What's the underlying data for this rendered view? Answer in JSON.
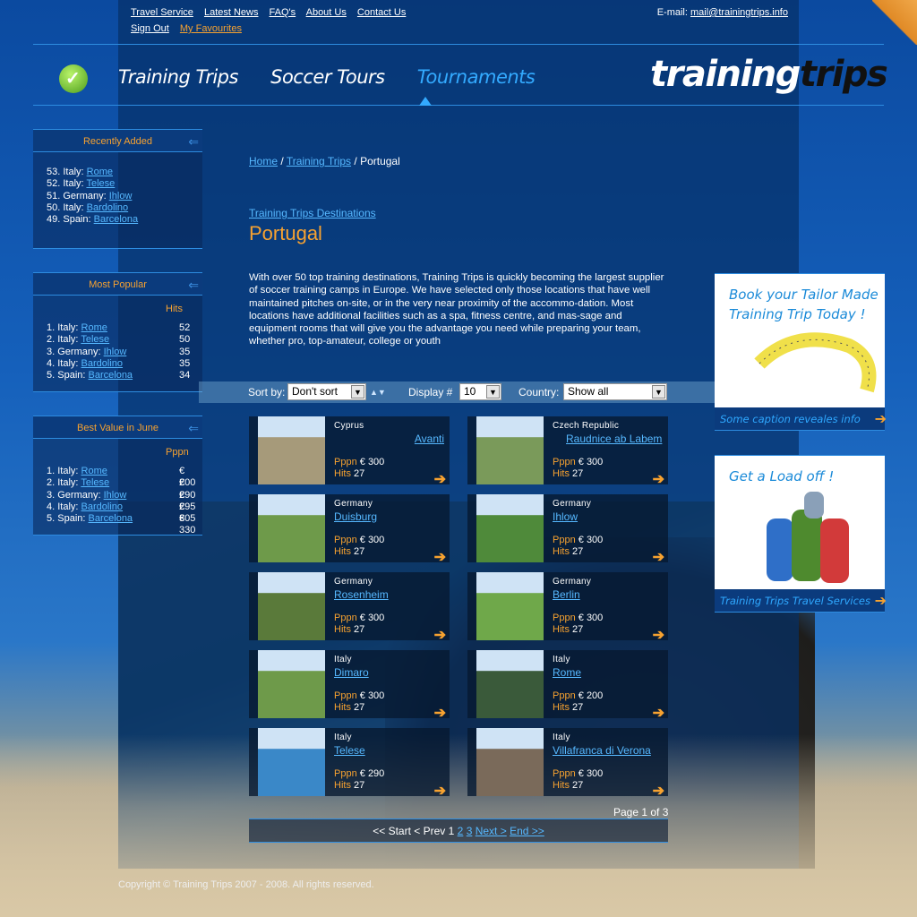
{
  "top_links": [
    "Travel Service",
    "Latest News",
    "FAQ's",
    "About Us",
    "Contact Us"
  ],
  "account_links": [
    "Sign Out",
    "My Favourites"
  ],
  "email": {
    "label": "E-mail:",
    "address": "mail@trainingtrips.info"
  },
  "main_nav": [
    "Training Trips",
    "Soccer Tours",
    "Tournaments"
  ],
  "active_nav": "Tournaments",
  "logo": {
    "part1": "training",
    "part2": "trips"
  },
  "recently_added": {
    "title": "Recently Added",
    "items": [
      {
        "num": "53.",
        "country": "Italy:",
        "city": "Rome"
      },
      {
        "num": "52.",
        "country": "Italy:",
        "city": "Telese"
      },
      {
        "num": "51.",
        "country": "Germany:",
        "city": "Ihlow"
      },
      {
        "num": "50.",
        "country": "Italy:",
        "city": "Bardolino"
      },
      {
        "num": "49.",
        "country": "Spain:",
        "city": "Barcelona"
      }
    ]
  },
  "most_popular": {
    "title": "Most Popular",
    "col": "Hits",
    "items": [
      {
        "num": "1.",
        "country": "Italy:",
        "city": "Rome",
        "val": "52"
      },
      {
        "num": "2.",
        "country": "Italy:",
        "city": "Telese",
        "val": "50"
      },
      {
        "num": "3.",
        "country": "Germany:",
        "city": "Ihlow",
        "val": "35"
      },
      {
        "num": "4.",
        "country": "Italy:",
        "city": "Bardolino",
        "val": "35"
      },
      {
        "num": "5.",
        "country": "Spain:",
        "city": "Barcelona",
        "val": "34"
      }
    ]
  },
  "best_value": {
    "title": "Best Value in June",
    "col": "Pppn",
    "items": [
      {
        "num": "1.",
        "country": "Italy:",
        "city": "Rome",
        "val": "€ 200"
      },
      {
        "num": "2.",
        "country": "Italy:",
        "city": "Telese",
        "val": "€ 290"
      },
      {
        "num": "3.",
        "country": "Germany:",
        "city": "Ihlow",
        "val": "€ 295"
      },
      {
        "num": "4.",
        "country": "Italy:",
        "city": "Bardolino",
        "val": "€ 305"
      },
      {
        "num": "5.",
        "country": "Spain:",
        "city": "Barcelona",
        "val": "€ 330"
      }
    ]
  },
  "breadcrumb": {
    "home": "Home",
    "sep": " / ",
    "section": "Training Trips",
    "current": "Portugal"
  },
  "dest_link": "Training Trips Destinations",
  "page_title": "Portugal",
  "intro": "With over 50 top training destinations, Training Trips is quickly becoming the largest supplier of soccer training camps in Europe. We have selected only those locations that have well maintained pitches on-site, or in the very near proximity of the accommo-dation. Most locations have additional facilities such as a spa, fitness centre, and mas-sage and equipment rooms that will give you the advantage you need while preparing your team, whether pro, top-amateur, college or youth",
  "filters": {
    "sort_label": "Sort by:",
    "sort_value": "Don't sort",
    "display_label": "Display #",
    "display_value": "10",
    "country_label": "Country:",
    "country_value": "Show all"
  },
  "cards": [
    {
      "country": "Cyprus",
      "city": "Avanti",
      "pppn_label": "Pppn",
      "price": "€ 300",
      "hits_label": "Hits",
      "hits": "27",
      "photo": "#a69a7a"
    },
    {
      "country": "Czech Republic",
      "city": "Raudnice ab Labem",
      "pppn_label": "Pppn",
      "price": "€ 300",
      "hits_label": "Hits",
      "hits": "27",
      "photo": "#7a9a5a"
    },
    {
      "country": "Germany",
      "city": "Duisburg",
      "pppn_label": "Pppn",
      "price": "€ 300",
      "hits_label": "Hits",
      "hits": "27",
      "photo": "#6e9a4a"
    },
    {
      "country": "Germany",
      "city": "Ihlow",
      "pppn_label": "Pppn",
      "price": "€ 300",
      "hits_label": "Hits",
      "hits": "27",
      "photo": "#4f8a3a"
    },
    {
      "country": "Germany",
      "city": "Rosenheim",
      "pppn_label": "Pppn",
      "price": "€ 300",
      "hits_label": "Hits",
      "hits": "27",
      "photo": "#5a7a3a"
    },
    {
      "country": "Germany",
      "city": "Berlin",
      "pppn_label": "Pppn",
      "price": "€ 300",
      "hits_label": "Hits",
      "hits": "27",
      "photo": "#6fa84a"
    },
    {
      "country": "Italy",
      "city": "Dimaro",
      "pppn_label": "Pppn",
      "price": "€ 300",
      "hits_label": "Hits",
      "hits": "27",
      "photo": "#6e9a4a"
    },
    {
      "country": "Italy",
      "city": "Rome",
      "pppn_label": "Pppn",
      "price": "€ 200",
      "hits_label": "Hits",
      "hits": "27",
      "photo": "#3a5a3a"
    },
    {
      "country": "Italy",
      "city": "Telese",
      "pppn_label": "Pppn",
      "price": "€ 290",
      "hits_label": "Hits",
      "hits": "27",
      "photo": "#3a88c8"
    },
    {
      "country": "Italy",
      "city": "Villafranca di Verona",
      "pppn_label": "Pppn",
      "price": "€ 300",
      "hits_label": "Hits",
      "hits": "27",
      "photo": "#7a6a5a"
    }
  ],
  "page_info": "Page 1 of 3",
  "pager": {
    "start": "<< Start",
    "prev": "< Prev",
    "cur": "1",
    "p2": "2",
    "p3": "3",
    "next": "Next >",
    "end": "End >>"
  },
  "promos": [
    {
      "text1": "Book your Tailor Made",
      "text2": "Training Trip Today !",
      "caption": "Some caption reveales info"
    },
    {
      "text1": "Get a Load off !",
      "text2": "",
      "caption": "Training Trips Travel Services"
    }
  ],
  "copyright": "Copyright © Training Trips 2007 - 2008. All rights reserved."
}
